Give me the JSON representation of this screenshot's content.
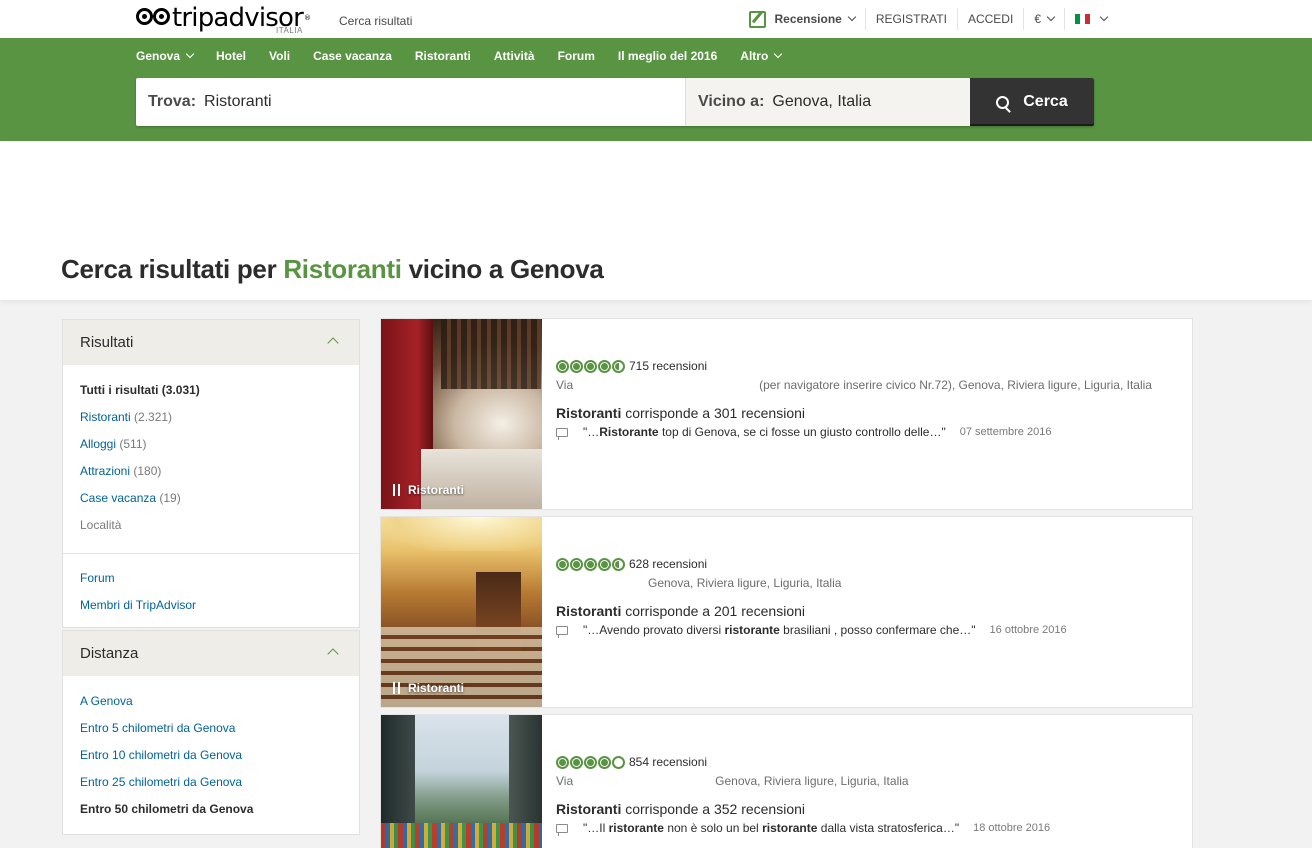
{
  "header": {
    "logo_text_1": "trip",
    "logo_text_2": "advisor",
    "logo_sub": "ITALIA",
    "breadcrumb": "Cerca risultati",
    "nav": {
      "review": "Recensione",
      "register": "REGISTRATI",
      "login": "ACCEDI",
      "currency": "€"
    }
  },
  "main_nav": [
    "Genova",
    "Hotel",
    "Voli",
    "Case vacanza",
    "Ristoranti",
    "Attività",
    "Forum",
    "Il meglio del 2016",
    "Altro"
  ],
  "search": {
    "find_label": "Trova:",
    "find_value": "Ristoranti",
    "near_label": "Vicino a:",
    "near_value": "Genova, Italia",
    "button": "Cerca"
  },
  "page": {
    "title_pre": "Cerca risultati per",
    "title_hl": "Ristoranti",
    "title_post": "vicino a Genova"
  },
  "sidebar": {
    "results": {
      "title": "Risultati",
      "items": [
        {
          "label": "Tutti i risultati (3.031)",
          "count": ""
        },
        {
          "label": "Ristoranti",
          "count": "(2.321)"
        },
        {
          "label": "Alloggi",
          "count": "(511)"
        },
        {
          "label": "Attrazioni",
          "count": "(180)"
        },
        {
          "label": "Case vacanza",
          "count": "(19)"
        },
        {
          "label": "Località",
          "count": ""
        }
      ],
      "links": [
        "Forum",
        "Membri di TripAdvisor"
      ]
    },
    "distance": {
      "title": "Distanza",
      "items": [
        "A Genova",
        "Entro 5 chilometri da Genova",
        "Entro 10 chilometri da Genova",
        "Entro 25 chilometri da Genova",
        "Entro 50 chilometri da Genova"
      ]
    }
  },
  "results": [
    {
      "category": "Ristoranti",
      "rating": 4.5,
      "reviews": "715 recensioni",
      "addr_prefix": "Via",
      "addr": "(per navigatore inserire civico Nr.72), Genova, Riviera ligure, Liguria, Italia",
      "match_bold": "Ristoranti",
      "match_rest": "corrisponde a 301 recensioni",
      "snip_pre": "\"…",
      "snip_bold": "Ristorante",
      "snip_post": "top di Genova, se ci fosse un giusto controllo delle…\"",
      "date": "07 settembre 2016"
    },
    {
      "category": "Ristoranti",
      "rating": 4.5,
      "reviews": "628 recensioni",
      "addr_prefix": "",
      "addr": "Genova, Riviera ligure, Liguria, Italia",
      "match_bold": "Ristoranti",
      "match_rest": "corrisponde a 201 recensioni",
      "snip_pre": "\"…Avendo provato diversi",
      "snip_bold": "ristorante",
      "snip_post": "brasiliani , posso confermare che…\"",
      "date": "16 ottobre 2016"
    },
    {
      "category": "",
      "rating": 4,
      "reviews": "854 recensioni",
      "addr_prefix": "Via",
      "addr": "Genova, Riviera ligure, Liguria, Italia",
      "match_bold": "Ristoranti",
      "match_rest": "corrisponde a 352 recensioni",
      "snip_pre": "\"…Il",
      "snip_bold": "ristorante",
      "snip_mid": "non è solo un bel",
      "snip_bold2": "ristorante",
      "snip_post": "dalla vista stratosferica…\"",
      "date": "18 ottobre 2016"
    }
  ],
  "colors": {
    "brand_green": "#589442",
    "link_blue": "#00629b",
    "search_btn": "#333333"
  }
}
